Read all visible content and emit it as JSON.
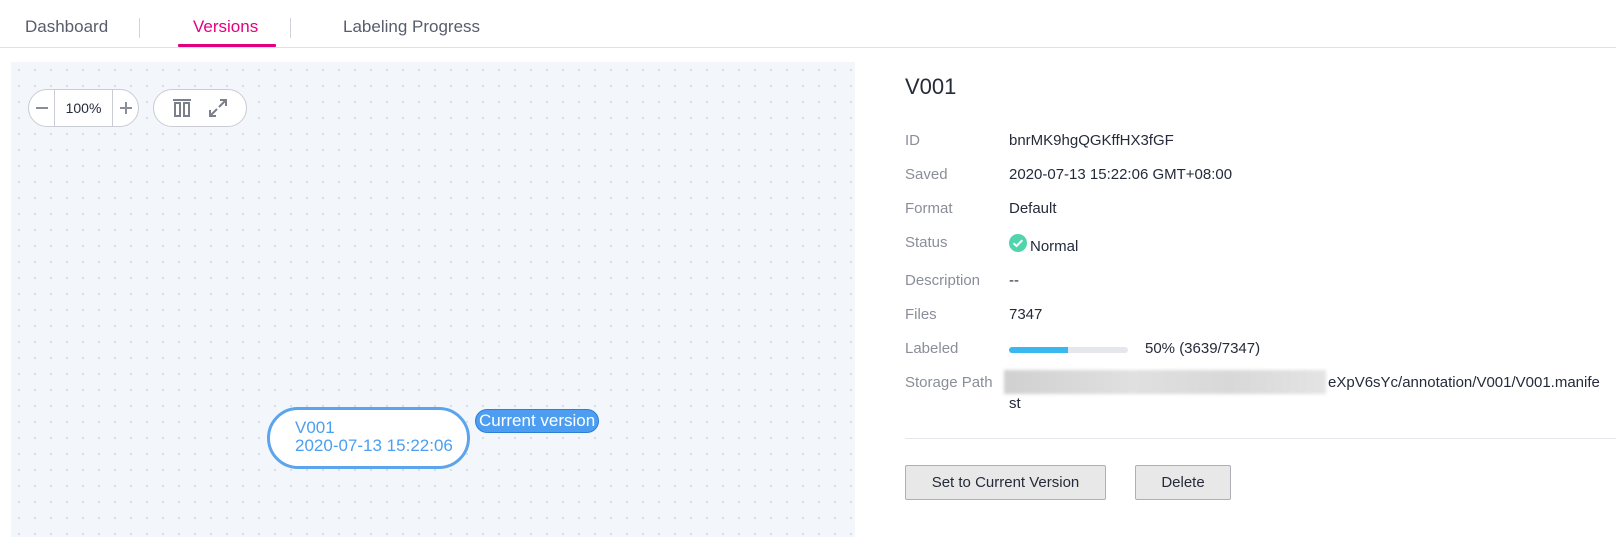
{
  "tabs": [
    {
      "label": "Dashboard",
      "active": false
    },
    {
      "label": "Versions",
      "active": true
    },
    {
      "label": "Labeling Progress",
      "active": false
    }
  ],
  "canvas": {
    "zoom": "100%",
    "zoom_out_icon": "minus-icon",
    "zoom_in_icon": "plus-icon",
    "layout_icon": "align-top-icon",
    "fullscreen_icon": "expand-icon",
    "node": {
      "name": "V001",
      "time": "2020-07-13 15:22:06"
    },
    "current_badge": "Current version"
  },
  "details": {
    "title": "V001",
    "fields": {
      "id": {
        "label": "ID",
        "value": "bnrMK9hgQGKffHX3fGF"
      },
      "saved": {
        "label": "Saved",
        "value": "2020-07-13 15:22:06 GMT+08:00"
      },
      "format": {
        "label": "Format",
        "value": "Default"
      },
      "status": {
        "label": "Status",
        "value": "Normal",
        "icon": "check-circle-icon",
        "color": "#50d4ab"
      },
      "description": {
        "label": "Description",
        "value": "--"
      },
      "files": {
        "label": "Files",
        "value": "7347"
      },
      "labeled": {
        "label": "Labeled",
        "value": "50% (3639/7347)",
        "fraction": 0.495
      },
      "storage_path": {
        "label": "Storage Path",
        "value_visible": "eXpV6sYc/annotation/V001/V001.manife",
        "value_wrap": "st"
      }
    },
    "buttons": {
      "set_current": "Set to Current Version",
      "delete": "Delete"
    }
  },
  "colors": {
    "accent": "#e3007f",
    "node_blue": "#4b9ff0",
    "progress": "#38b8ef"
  }
}
